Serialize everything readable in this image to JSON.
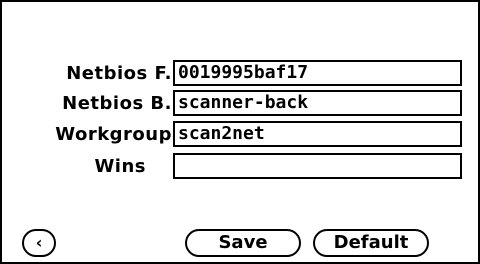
{
  "form": {
    "fields": [
      {
        "label": "Netbios F.",
        "value": "0019995baf17"
      },
      {
        "label": "Netbios B.",
        "value": "scanner-back"
      },
      {
        "label": "Workgroup",
        "value": "scan2net"
      },
      {
        "label": "Wins",
        "value": ""
      }
    ]
  },
  "buttons": {
    "back_glyph": "‹",
    "back_icon": "chevron-left-icon",
    "save_label": "Save",
    "default_label": "Default"
  }
}
